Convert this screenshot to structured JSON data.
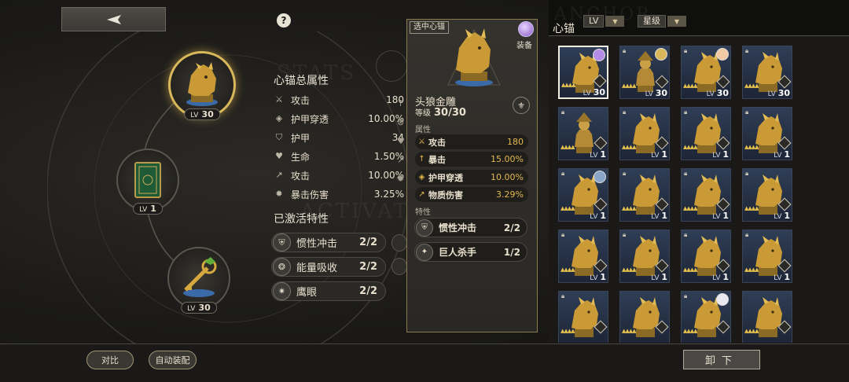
{
  "nav": {
    "back_icon": "back-arrow-icon",
    "help_label": "?"
  },
  "slots": [
    {
      "lv_label": "LV",
      "level": "30",
      "item": "wolf-head-golden-bust"
    },
    {
      "lv_label": "LV",
      "level": "1",
      "item": "green-tome"
    },
    {
      "lv_label": "LV",
      "level": "30",
      "item": "golden-key"
    }
  ],
  "total_stats": {
    "title": "心锚总属性",
    "rows": [
      {
        "icon": "sword-icon",
        "name": "攻击",
        "value": "180"
      },
      {
        "icon": "armor-pierce-icon",
        "name": "护甲穿透",
        "value": "10.00%"
      },
      {
        "icon": "shield-icon",
        "name": "护甲",
        "value": "34"
      },
      {
        "icon": "heart-icon",
        "name": "生命",
        "value": "1.50%"
      },
      {
        "icon": "attack-up-icon",
        "name": "攻击",
        "value": "10.00%"
      },
      {
        "icon": "crit-damage-icon",
        "name": "暴击伤害",
        "value": "3.25%"
      }
    ]
  },
  "active_traits": {
    "title": "已激活特性",
    "items": [
      {
        "icon": "inertia-icon",
        "name": "惯性冲击",
        "value": "2/2"
      },
      {
        "icon": "energy-absorb-icon",
        "name": "能量吸收",
        "value": "2/2"
      },
      {
        "icon": "hawkeye-icon",
        "name": "鹰眼",
        "value": "2/2"
      }
    ]
  },
  "selected": {
    "header": "选中心锚",
    "equip_label": "装备",
    "item_name": "头狼金雕",
    "level_label": "等级",
    "level_value": "30/30",
    "attr_title": "属性",
    "attrs": [
      {
        "name": "攻击",
        "value": "180"
      },
      {
        "name": "暴击",
        "value": "15.00%"
      },
      {
        "name": "护甲穿透",
        "value": "10.00%"
      },
      {
        "name": "物质伤害",
        "value": "3.29%"
      }
    ],
    "trait_title": "特性",
    "traits": [
      {
        "name": "惯性冲击",
        "value": "2/2"
      },
      {
        "name": "巨人杀手",
        "value": "1/2"
      }
    ]
  },
  "inventory": {
    "title": "心锚",
    "filter_lv": "LV",
    "filter_star": "星级",
    "cells": [
      {
        "type": "wolf",
        "level": "30",
        "locked": false,
        "avatar": "purple",
        "selected": true
      },
      {
        "type": "statue",
        "level": "30",
        "locked": true,
        "avatar": "gold",
        "selected": false
      },
      {
        "type": "wolf",
        "level": "30",
        "locked": true,
        "avatar": "orange",
        "selected": false
      },
      {
        "type": "wolf",
        "level": "30",
        "locked": true,
        "avatar": "",
        "selected": false
      },
      {
        "type": "statue",
        "level": "1",
        "locked": true,
        "avatar": "",
        "selected": false
      },
      {
        "type": "wolf",
        "level": "1",
        "locked": true,
        "avatar": "",
        "selected": false
      },
      {
        "type": "wolf",
        "level": "1",
        "locked": true,
        "avatar": "",
        "selected": false
      },
      {
        "type": "wolf",
        "level": "1",
        "locked": true,
        "avatar": "",
        "selected": false
      },
      {
        "type": "wolf",
        "level": "1",
        "locked": true,
        "avatar": "blue",
        "selected": false
      },
      {
        "type": "wolf",
        "level": "1",
        "locked": true,
        "avatar": "",
        "selected": false
      },
      {
        "type": "wolf",
        "level": "1",
        "locked": true,
        "avatar": "",
        "selected": false
      },
      {
        "type": "wolf",
        "level": "1",
        "locked": true,
        "avatar": "",
        "selected": false
      },
      {
        "type": "wolf",
        "level": "1",
        "locked": true,
        "avatar": "",
        "selected": false
      },
      {
        "type": "wolf",
        "level": "1",
        "locked": true,
        "avatar": "",
        "selected": false
      },
      {
        "type": "wolf",
        "level": "1",
        "locked": true,
        "avatar": "",
        "selected": false
      },
      {
        "type": "wolf",
        "level": "1",
        "locked": true,
        "avatar": "",
        "selected": false
      },
      {
        "type": "wolf",
        "level": "",
        "locked": true,
        "avatar": "",
        "selected": false
      },
      {
        "type": "wolf",
        "level": "",
        "locked": false,
        "avatar": "",
        "selected": false
      },
      {
        "type": "wolf",
        "level": "",
        "locked": true,
        "avatar": "white",
        "selected": false
      },
      {
        "type": "wolf",
        "level": "",
        "locked": false,
        "avatar": "",
        "selected": false
      }
    ]
  },
  "bottom": {
    "compare": "对比",
    "auto_equip": "自动装配",
    "unequip": "卸下"
  },
  "colors": {
    "gold": "#e3b850",
    "panel_border": "#8b7a4f",
    "cell_blue": "#2f3e56"
  }
}
